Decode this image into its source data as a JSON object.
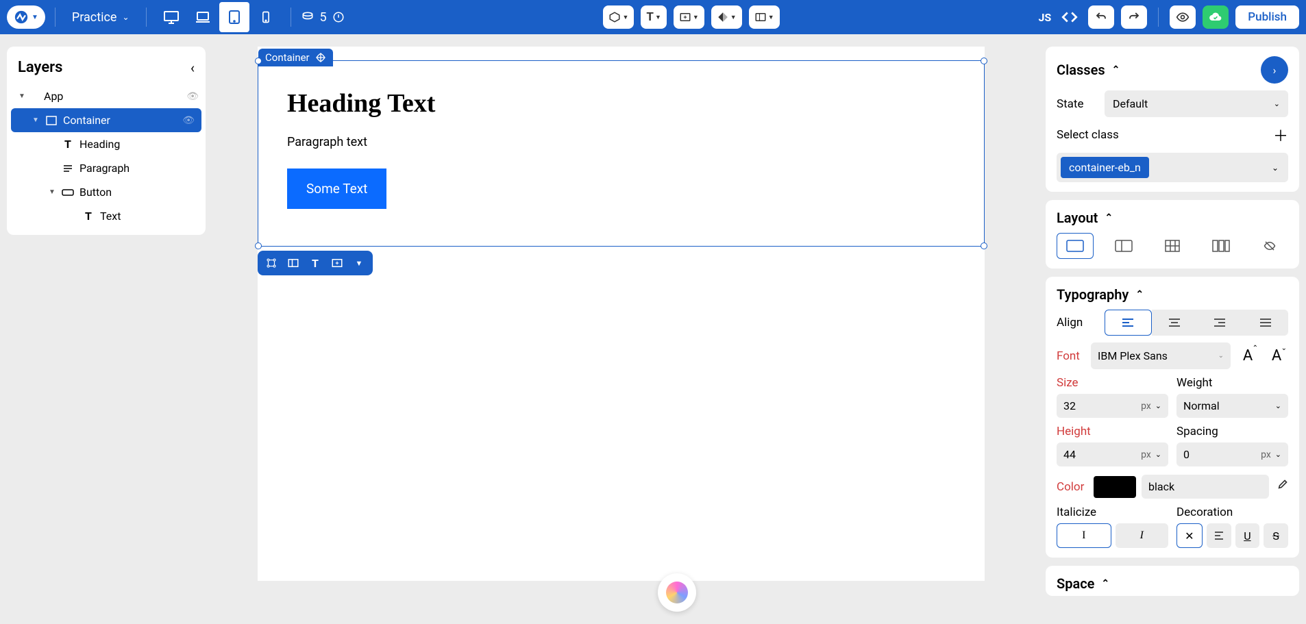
{
  "topbar": {
    "page_name": "Practice",
    "cms_count": "5",
    "js_label": "JS",
    "publish": "Publish"
  },
  "layers": {
    "title": "Layers",
    "items": [
      {
        "label": "App",
        "icon": "app"
      },
      {
        "label": "Container",
        "icon": "container",
        "selected": true
      },
      {
        "label": "Heading",
        "icon": "text"
      },
      {
        "label": "Paragraph",
        "icon": "para"
      },
      {
        "label": "Button",
        "icon": "button"
      },
      {
        "label": "Text",
        "icon": "text"
      }
    ]
  },
  "canvas": {
    "selected_label": "Container",
    "heading": "Heading Text",
    "paragraph": "Paragraph text",
    "button": "Some Text"
  },
  "classes": {
    "title": "Classes",
    "state_label": "State",
    "state_value": "Default",
    "select_class_label": "Select class",
    "chip": "container-eb_n"
  },
  "layout": {
    "title": "Layout"
  },
  "typography": {
    "title": "Typography",
    "align_label": "Align",
    "font_label": "Font",
    "font_value": "IBM Plex Sans",
    "size_label": "Size",
    "size_value": "32",
    "size_unit": "px",
    "weight_label": "Weight",
    "weight_value": "Normal",
    "height_label": "Height",
    "height_value": "44",
    "height_unit": "px",
    "spacing_label": "Spacing",
    "spacing_value": "0",
    "spacing_unit": "px",
    "color_label": "Color",
    "color_value": "black",
    "italicize_label": "Italicize",
    "decoration_label": "Decoration"
  },
  "space": {
    "title": "Space"
  }
}
